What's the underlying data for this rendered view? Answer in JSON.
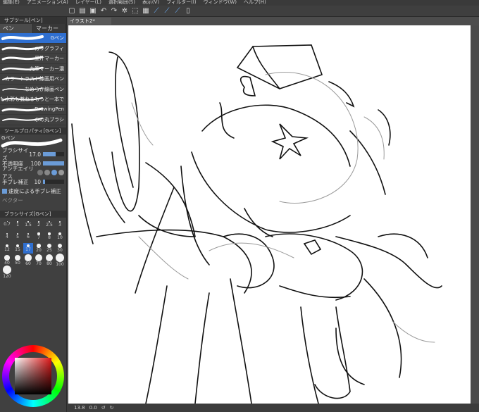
{
  "menu": [
    "編集(E)",
    "アニメーション(A)",
    "レイヤー(L)",
    "選択範囲(S)",
    "表示(V)",
    "フィルター(I)",
    "ウィンドウ(W)",
    "ヘルプ(H)"
  ],
  "toolbar_icons": [
    "new-icon",
    "open-icon",
    "save-icon",
    "undo-icon",
    "redo-icon",
    "settings-icon",
    "transform-icon",
    "select-icon",
    "pen-a-icon",
    "pen-b-icon",
    "pen-c-icon",
    "phone-icon"
  ],
  "subtool": {
    "header": "サブツール[ペン]",
    "tabs": [
      "ペン",
      "マーカー"
    ],
    "brushes": [
      "Gペン",
      "カリグラフィ",
      "墨汁マーカー",
      "丸筆マーカー濃",
      "カラートラスト線画用ペン",
      "なめらか線画ペン",
      "主線も水彩も兼ねるもっと一本で",
      "DrawingPen",
      "水の丸ブラシ"
    ],
    "selected": 0
  },
  "tool_property": {
    "header": "ツールプロパティ[Gペン]",
    "name": "Gペン",
    "brush_size_label": "ブラシサイズ",
    "brush_size": "17.0",
    "opacity_label": "不透明度",
    "opacity": "100",
    "antialias_label": "アンチエイリアス",
    "stabilization_label": "手ブレ補正",
    "stabilization": "10",
    "speed_label": "速度による手ブレ補正",
    "speed_checked": true,
    "vector_label": "ベクター"
  },
  "brush_size_panel": {
    "header": "ブラシサイズ[Gペン]",
    "sizes": [
      "0.7",
      "1",
      "1.5",
      "2",
      "2.5",
      "3",
      "4",
      "5",
      "6",
      "7",
      "8",
      "10",
      "12",
      "15",
      "17",
      "20",
      "25",
      "30",
      "40",
      "50",
      "60",
      "70",
      "80",
      "100",
      "120"
    ],
    "selected": "17"
  },
  "document_tab": "イラスト2*",
  "status": {
    "zoom": "13.8",
    "angle": "0.0"
  },
  "accent_color": "#2f6fd0"
}
